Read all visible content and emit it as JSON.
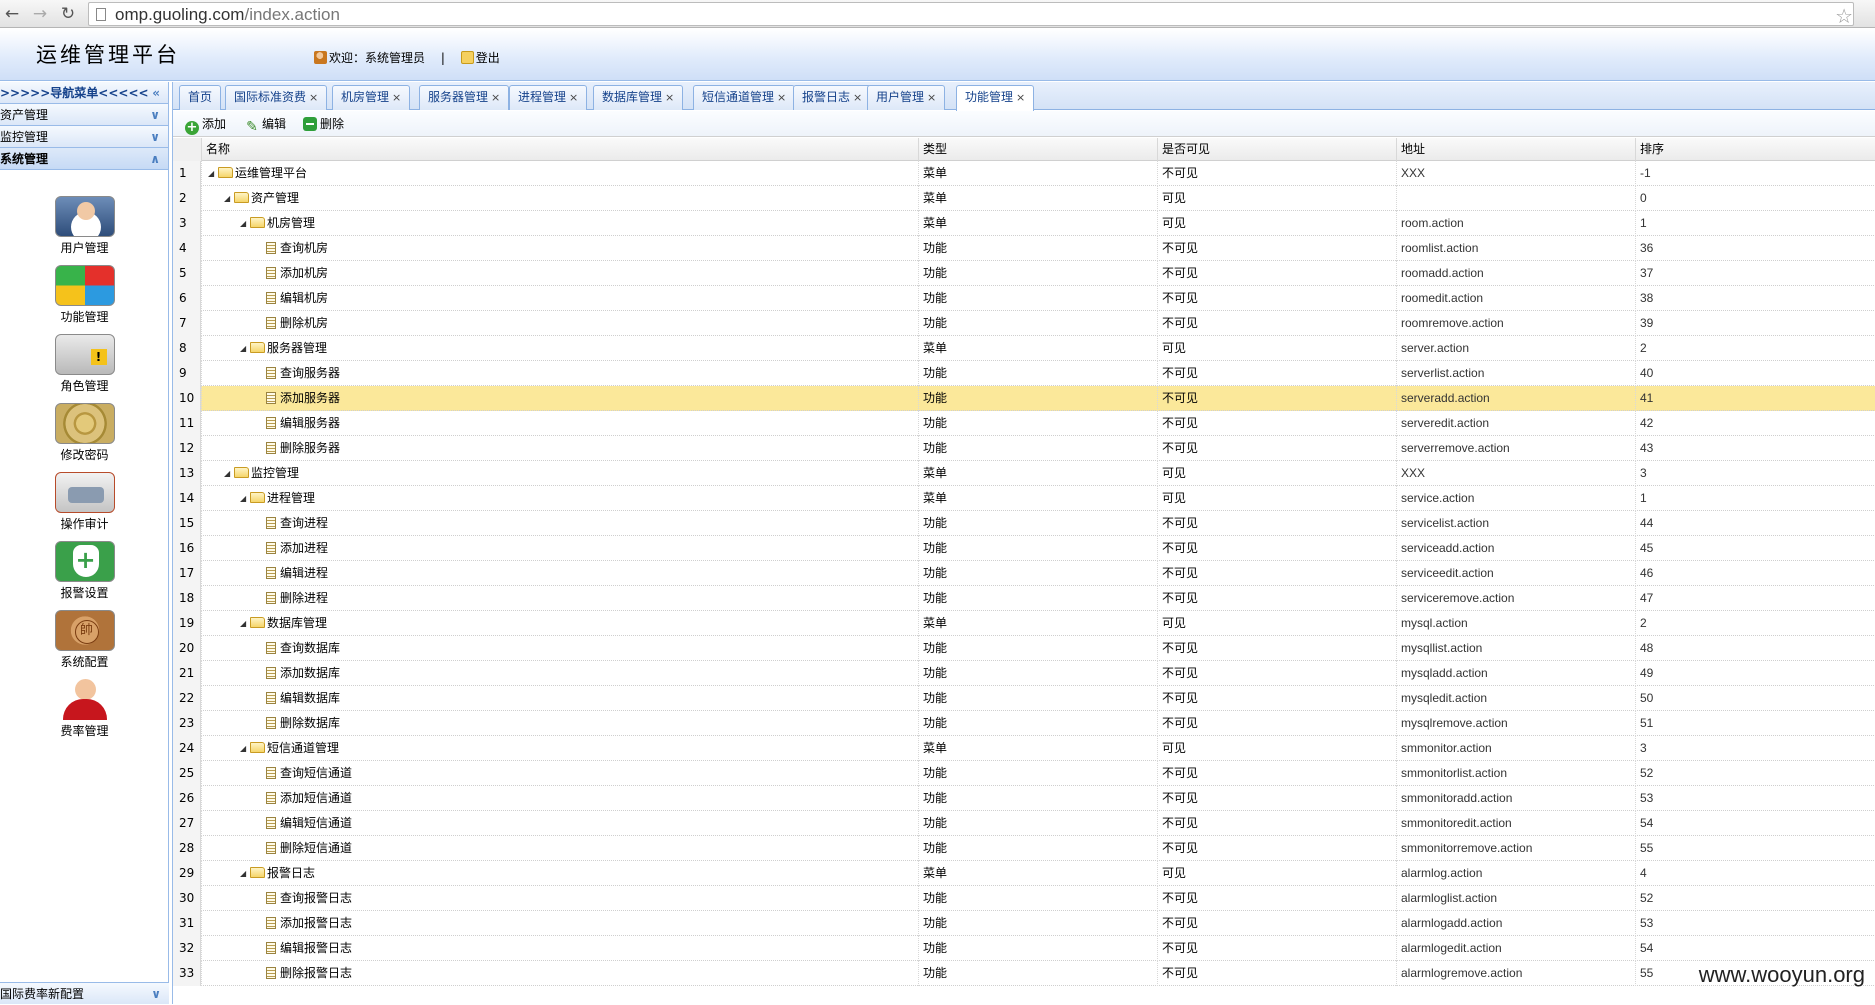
{
  "browser": {
    "url_domain": "omp.guoling.com",
    "url_path": "/index.action"
  },
  "header": {
    "title": "运维管理平台",
    "welcome": "欢迎：系统管理员",
    "separator": "|",
    "logout": "登出"
  },
  "sidebar": {
    "nav_title": ">>>>>导航菜单<<<<<",
    "sections": [
      "资产管理",
      "监控管理",
      "系统管理"
    ],
    "tools": [
      {
        "label": "用户管理",
        "icon": "user-admin-icon"
      },
      {
        "label": "功能管理",
        "icon": "function-grid-icon"
      },
      {
        "label": "角色管理",
        "icon": "role-warning-icon"
      },
      {
        "label": "修改密码",
        "icon": "password-safe-icon"
      },
      {
        "label": "操作审计",
        "icon": "audit-car-icon"
      },
      {
        "label": "报警设置",
        "icon": "alarm-shield-icon"
      },
      {
        "label": "系统配置",
        "icon": "config-chess-icon"
      },
      {
        "label": "费率管理",
        "icon": "rate-person-icon"
      }
    ],
    "bottom_section": "国际费率新配置"
  },
  "tabs": [
    {
      "label": "首页",
      "closable": false
    },
    {
      "label": "国际标准资费",
      "closable": true
    },
    {
      "label": "机房管理",
      "closable": true
    },
    {
      "label": "服务器管理",
      "closable": true
    },
    {
      "label": "进程管理",
      "closable": true
    },
    {
      "label": "数据库管理",
      "closable": true
    },
    {
      "label": "短信通道管理",
      "closable": true
    },
    {
      "label": "报警日志",
      "closable": true
    },
    {
      "label": "用户管理",
      "closable": true
    },
    {
      "label": "功能管理",
      "closable": true,
      "active": true
    }
  ],
  "toolbar": {
    "add": "添加",
    "edit": "编辑",
    "remove": "删除"
  },
  "grid": {
    "columns": [
      "名称",
      "类型",
      "是否可见",
      "地址",
      "排序"
    ],
    "selected_row": 10,
    "rows": [
      {
        "num": "1",
        "level": 0,
        "kind": "folder",
        "name": "运维管理平台",
        "type": "菜单",
        "visible": "不可见",
        "url": "XXX",
        "sort": "-1"
      },
      {
        "num": "2",
        "level": 1,
        "kind": "folder",
        "name": "资产管理",
        "type": "菜单",
        "visible": "可见",
        "url": "",
        "sort": "0"
      },
      {
        "num": "3",
        "level": 2,
        "kind": "folder",
        "name": "机房管理",
        "type": "菜单",
        "visible": "可见",
        "url": "room.action",
        "sort": "1"
      },
      {
        "num": "4",
        "level": 3,
        "kind": "file",
        "name": "查询机房",
        "type": "功能",
        "visible": "不可见",
        "url": "roomlist.action",
        "sort": "36"
      },
      {
        "num": "5",
        "level": 3,
        "kind": "file",
        "name": "添加机房",
        "type": "功能",
        "visible": "不可见",
        "url": "roomadd.action",
        "sort": "37"
      },
      {
        "num": "6",
        "level": 3,
        "kind": "file",
        "name": "编辑机房",
        "type": "功能",
        "visible": "不可见",
        "url": "roomedit.action",
        "sort": "38"
      },
      {
        "num": "7",
        "level": 3,
        "kind": "file",
        "name": "删除机房",
        "type": "功能",
        "visible": "不可见",
        "url": "roomremove.action",
        "sort": "39"
      },
      {
        "num": "8",
        "level": 2,
        "kind": "folder",
        "name": "服务器管理",
        "type": "菜单",
        "visible": "可见",
        "url": "server.action",
        "sort": "2"
      },
      {
        "num": "9",
        "level": 3,
        "kind": "file",
        "name": "查询服务器",
        "type": "功能",
        "visible": "不可见",
        "url": "serverlist.action",
        "sort": "40"
      },
      {
        "num": "10",
        "level": 3,
        "kind": "file",
        "name": "添加服务器",
        "type": "功能",
        "visible": "不可见",
        "url": "serveradd.action",
        "sort": "41"
      },
      {
        "num": "11",
        "level": 3,
        "kind": "file",
        "name": "编辑服务器",
        "type": "功能",
        "visible": "不可见",
        "url": "serveredit.action",
        "sort": "42"
      },
      {
        "num": "12",
        "level": 3,
        "kind": "file",
        "name": "删除服务器",
        "type": "功能",
        "visible": "不可见",
        "url": "serverremove.action",
        "sort": "43"
      },
      {
        "num": "13",
        "level": 1,
        "kind": "folder",
        "name": "监控管理",
        "type": "菜单",
        "visible": "可见",
        "url": "XXX",
        "sort": "3"
      },
      {
        "num": "14",
        "level": 2,
        "kind": "folder",
        "name": "进程管理",
        "type": "菜单",
        "visible": "可见",
        "url": "service.action",
        "sort": "1"
      },
      {
        "num": "15",
        "level": 3,
        "kind": "file",
        "name": "查询进程",
        "type": "功能",
        "visible": "不可见",
        "url": "servicelist.action",
        "sort": "44"
      },
      {
        "num": "16",
        "level": 3,
        "kind": "file",
        "name": "添加进程",
        "type": "功能",
        "visible": "不可见",
        "url": "serviceadd.action",
        "sort": "45"
      },
      {
        "num": "17",
        "level": 3,
        "kind": "file",
        "name": "编辑进程",
        "type": "功能",
        "visible": "不可见",
        "url": "serviceedit.action",
        "sort": "46"
      },
      {
        "num": "18",
        "level": 3,
        "kind": "file",
        "name": "删除进程",
        "type": "功能",
        "visible": "不可见",
        "url": "serviceremove.action",
        "sort": "47"
      },
      {
        "num": "19",
        "level": 2,
        "kind": "folder",
        "name": "数据库管理",
        "type": "菜单",
        "visible": "可见",
        "url": "mysql.action",
        "sort": "2"
      },
      {
        "num": "20",
        "level": 3,
        "kind": "file",
        "name": "查询数据库",
        "type": "功能",
        "visible": "不可见",
        "url": "mysqllist.action",
        "sort": "48"
      },
      {
        "num": "21",
        "level": 3,
        "kind": "file",
        "name": "添加数据库",
        "type": "功能",
        "visible": "不可见",
        "url": "mysqladd.action",
        "sort": "49"
      },
      {
        "num": "22",
        "level": 3,
        "kind": "file",
        "name": "编辑数据库",
        "type": "功能",
        "visible": "不可见",
        "url": "mysqledit.action",
        "sort": "50"
      },
      {
        "num": "23",
        "level": 3,
        "kind": "file",
        "name": "删除数据库",
        "type": "功能",
        "visible": "不可见",
        "url": "mysqlremove.action",
        "sort": "51"
      },
      {
        "num": "24",
        "level": 2,
        "kind": "folder",
        "name": "短信通道管理",
        "type": "菜单",
        "visible": "可见",
        "url": "smmonitor.action",
        "sort": "3"
      },
      {
        "num": "25",
        "level": 3,
        "kind": "file",
        "name": "查询短信通道",
        "type": "功能",
        "visible": "不可见",
        "url": "smmonitorlist.action",
        "sort": "52"
      },
      {
        "num": "26",
        "level": 3,
        "kind": "file",
        "name": "添加短信通道",
        "type": "功能",
        "visible": "不可见",
        "url": "smmonitoradd.action",
        "sort": "53"
      },
      {
        "num": "27",
        "level": 3,
        "kind": "file",
        "name": "编辑短信通道",
        "type": "功能",
        "visible": "不可见",
        "url": "smmonitoredit.action",
        "sort": "54"
      },
      {
        "num": "28",
        "level": 3,
        "kind": "file",
        "name": "删除短信通道",
        "type": "功能",
        "visible": "不可见",
        "url": "smmonitorremove.action",
        "sort": "55"
      },
      {
        "num": "29",
        "level": 2,
        "kind": "folder",
        "name": "报警日志",
        "type": "菜单",
        "visible": "可见",
        "url": "alarmlog.action",
        "sort": "4"
      },
      {
        "num": "30",
        "level": 3,
        "kind": "file",
        "name": "查询报警日志",
        "type": "功能",
        "visible": "不可见",
        "url": "alarmloglist.action",
        "sort": "52"
      },
      {
        "num": "31",
        "level": 3,
        "kind": "file",
        "name": "添加报警日志",
        "type": "功能",
        "visible": "不可见",
        "url": "alarmlogadd.action",
        "sort": "53"
      },
      {
        "num": "32",
        "level": 3,
        "kind": "file",
        "name": "编辑报警日志",
        "type": "功能",
        "visible": "不可见",
        "url": "alarmlogedit.action",
        "sort": "54"
      },
      {
        "num": "33",
        "level": 3,
        "kind": "file",
        "name": "删除报警日志",
        "type": "功能",
        "visible": "不可见",
        "url": "alarmlogremove.action",
        "sort": "55"
      }
    ]
  },
  "watermark": "www.wooyun.org"
}
